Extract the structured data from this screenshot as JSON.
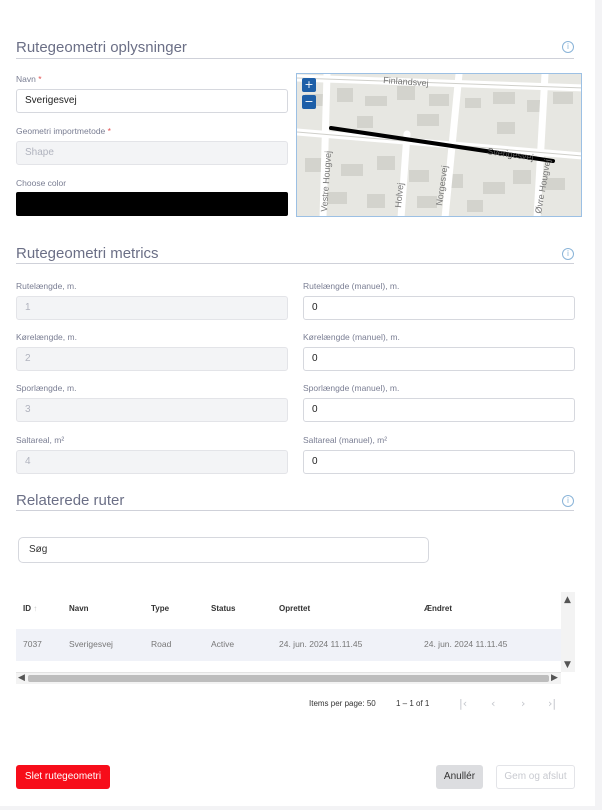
{
  "section1": {
    "title": "Rutegeometri oplysninger",
    "info_icon": "i",
    "navn_label": "Navn",
    "navn_required": "*",
    "navn_value": "Sverigesvej",
    "method_label": "Geometri importmetode",
    "method_required": "*",
    "method_value": "Shape",
    "color_label": "Choose color",
    "color_value": "#000000"
  },
  "map": {
    "zoom_in": "+",
    "zoom_out": "−",
    "street_labels": [
      "Finlandsvej",
      "Vestre Hougvej",
      "Norgesvej",
      "Holvej",
      "Sverigesvej",
      "Øvre Hougvej"
    ]
  },
  "section2": {
    "title": "Rutegeometri metrics",
    "info_icon": "i",
    "fields": [
      {
        "label": "Rutelængde, m.",
        "value": "1"
      },
      {
        "label": "Rutelængde (manuel), m.",
        "value": "0"
      },
      {
        "label": "Kørelængde, m.",
        "value": "2"
      },
      {
        "label": "Kørelængde (manuel), m.",
        "value": "0"
      },
      {
        "label": "Sporlængde, m.",
        "value": "3"
      },
      {
        "label": "Sporlængde (manuel), m.",
        "value": "0"
      },
      {
        "label": "Saltareal, m²",
        "value": "4"
      },
      {
        "label": "Saltareal (manuel), m²",
        "value": "0"
      }
    ]
  },
  "section3": {
    "title": "Relaterede ruter",
    "info_icon": "i",
    "search_placeholder": "Søg"
  },
  "table": {
    "columns": [
      "ID",
      "Navn",
      "Type",
      "Status",
      "Oprettet",
      "Ændret"
    ],
    "sort_icon": "↑",
    "rows": [
      {
        "id": "7037",
        "navn": "Sverigesvej",
        "type": "Road",
        "status": "Active",
        "oprettet": "24. jun. 2024 11.11.45",
        "aendret": "24. jun. 2024 11.11.45"
      }
    ]
  },
  "pager": {
    "items_per_page_label": "Items per page:",
    "items_per_page": "50",
    "range": "1 – 1 of 1",
    "first": "|‹",
    "prev": "‹",
    "next": "›",
    "last": "›|"
  },
  "actions": {
    "delete": "Slet rutegeometri",
    "cancel": "Anullér",
    "save": "Gem og afslut"
  },
  "colors": {
    "danger": "#f70d1a",
    "accent": "#1e5fa8"
  }
}
